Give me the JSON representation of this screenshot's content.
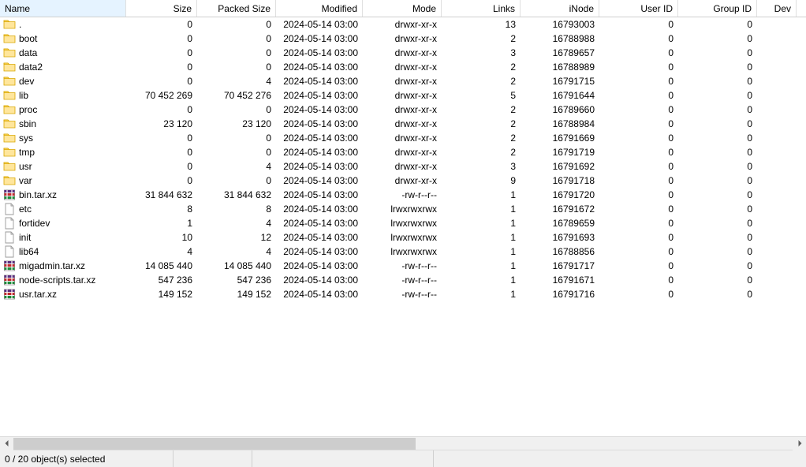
{
  "columns": {
    "name": "Name",
    "size": "Size",
    "packed": "Packed Size",
    "modified": "Modified",
    "mode": "Mode",
    "links": "Links",
    "inode": "iNode",
    "uid": "User ID",
    "gid": "Group ID",
    "dev": "Dev"
  },
  "rows": [
    {
      "icon": "folder",
      "name": ".",
      "size": "0",
      "packed": "0",
      "modified": "2024-05-14 03:00",
      "mode": "drwxr-xr-x",
      "links": "13",
      "inode": "16793003",
      "uid": "0",
      "gid": "0"
    },
    {
      "icon": "folder",
      "name": "boot",
      "size": "0",
      "packed": "0",
      "modified": "2024-05-14 03:00",
      "mode": "drwxr-xr-x",
      "links": "2",
      "inode": "16788988",
      "uid": "0",
      "gid": "0"
    },
    {
      "icon": "folder",
      "name": "data",
      "size": "0",
      "packed": "0",
      "modified": "2024-05-14 03:00",
      "mode": "drwxr-xr-x",
      "links": "3",
      "inode": "16789657",
      "uid": "0",
      "gid": "0"
    },
    {
      "icon": "folder",
      "name": "data2",
      "size": "0",
      "packed": "0",
      "modified": "2024-05-14 03:00",
      "mode": "drwxr-xr-x",
      "links": "2",
      "inode": "16788989",
      "uid": "0",
      "gid": "0"
    },
    {
      "icon": "folder",
      "name": "dev",
      "size": "0",
      "packed": "4",
      "modified": "2024-05-14 03:00",
      "mode": "drwxr-xr-x",
      "links": "2",
      "inode": "16791715",
      "uid": "0",
      "gid": "0"
    },
    {
      "icon": "folder",
      "name": "lib",
      "size": "70 452 269",
      "packed": "70 452 276",
      "modified": "2024-05-14 03:00",
      "mode": "drwxr-xr-x",
      "links": "5",
      "inode": "16791644",
      "uid": "0",
      "gid": "0"
    },
    {
      "icon": "folder",
      "name": "proc",
      "size": "0",
      "packed": "0",
      "modified": "2024-05-14 03:00",
      "mode": "drwxr-xr-x",
      "links": "2",
      "inode": "16789660",
      "uid": "0",
      "gid": "0"
    },
    {
      "icon": "folder",
      "name": "sbin",
      "size": "23 120",
      "packed": "23 120",
      "modified": "2024-05-14 03:00",
      "mode": "drwxr-xr-x",
      "links": "2",
      "inode": "16788984",
      "uid": "0",
      "gid": "0"
    },
    {
      "icon": "folder",
      "name": "sys",
      "size": "0",
      "packed": "0",
      "modified": "2024-05-14 03:00",
      "mode": "drwxr-xr-x",
      "links": "2",
      "inode": "16791669",
      "uid": "0",
      "gid": "0"
    },
    {
      "icon": "folder",
      "name": "tmp",
      "size": "0",
      "packed": "0",
      "modified": "2024-05-14 03:00",
      "mode": "drwxr-xr-x",
      "links": "2",
      "inode": "16791719",
      "uid": "0",
      "gid": "0"
    },
    {
      "icon": "folder",
      "name": "usr",
      "size": "0",
      "packed": "4",
      "modified": "2024-05-14 03:00",
      "mode": "drwxr-xr-x",
      "links": "3",
      "inode": "16791692",
      "uid": "0",
      "gid": "0"
    },
    {
      "icon": "folder",
      "name": "var",
      "size": "0",
      "packed": "0",
      "modified": "2024-05-14 03:00",
      "mode": "drwxr-xr-x",
      "links": "9",
      "inode": "16791718",
      "uid": "0",
      "gid": "0"
    },
    {
      "icon": "archive",
      "name": "bin.tar.xz",
      "size": "31 844 632",
      "packed": "31 844 632",
      "modified": "2024-05-14 03:00",
      "mode": "-rw-r--r--",
      "links": "1",
      "inode": "16791720",
      "uid": "0",
      "gid": "0"
    },
    {
      "icon": "file",
      "name": "etc",
      "size": "8",
      "packed": "8",
      "modified": "2024-05-14 03:00",
      "mode": "lrwxrwxrwx",
      "links": "1",
      "inode": "16791672",
      "uid": "0",
      "gid": "0"
    },
    {
      "icon": "file",
      "name": "fortidev",
      "size": "1",
      "packed": "4",
      "modified": "2024-05-14 03:00",
      "mode": "lrwxrwxrwx",
      "links": "1",
      "inode": "16789659",
      "uid": "0",
      "gid": "0"
    },
    {
      "icon": "file",
      "name": "init",
      "size": "10",
      "packed": "12",
      "modified": "2024-05-14 03:00",
      "mode": "lrwxrwxrwx",
      "links": "1",
      "inode": "16791693",
      "uid": "0",
      "gid": "0"
    },
    {
      "icon": "file",
      "name": "lib64",
      "size": "4",
      "packed": "4",
      "modified": "2024-05-14 03:00",
      "mode": "lrwxrwxrwx",
      "links": "1",
      "inode": "16788856",
      "uid": "0",
      "gid": "0"
    },
    {
      "icon": "archive",
      "name": "migadmin.tar.xz",
      "size": "14 085 440",
      "packed": "14 085 440",
      "modified": "2024-05-14 03:00",
      "mode": "-rw-r--r--",
      "links": "1",
      "inode": "16791717",
      "uid": "0",
      "gid": "0"
    },
    {
      "icon": "archive",
      "name": "node-scripts.tar.xz",
      "size": "547 236",
      "packed": "547 236",
      "modified": "2024-05-14 03:00",
      "mode": "-rw-r--r--",
      "links": "1",
      "inode": "16791671",
      "uid": "0",
      "gid": "0"
    },
    {
      "icon": "archive",
      "name": "usr.tar.xz",
      "size": "149 152",
      "packed": "149 152",
      "modified": "2024-05-14 03:00",
      "mode": "-rw-r--r--",
      "links": "1",
      "inode": "16791716",
      "uid": "0",
      "gid": "0"
    }
  ],
  "status": {
    "selection": "0 / 20 object(s) selected"
  }
}
